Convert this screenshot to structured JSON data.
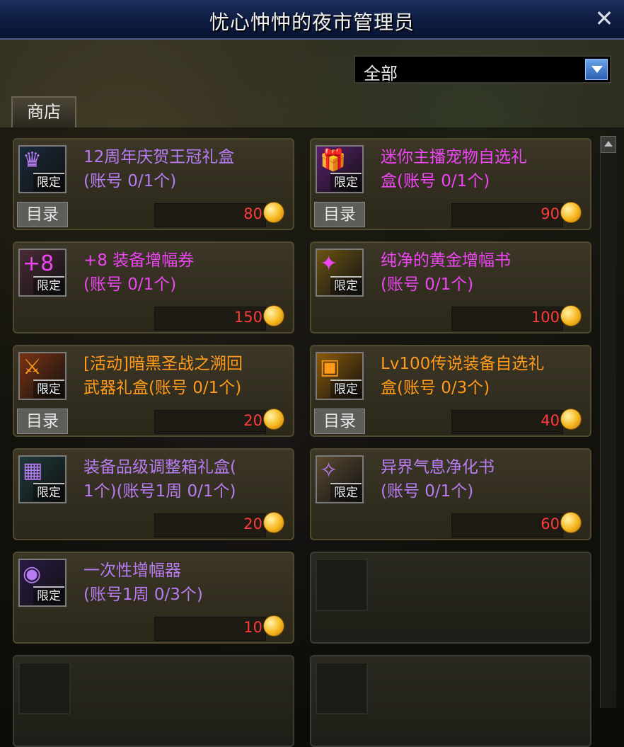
{
  "window": {
    "title": "忧心忡忡的夜市管理员",
    "close_icon": "close-icon"
  },
  "filter": {
    "selected": "全部"
  },
  "tabs": [
    {
      "label": "商店"
    }
  ],
  "colors": {
    "purple_name": "#b87cf2",
    "magenta_name": "#f045f5",
    "orange_name": "#ff9a1a",
    "price": "#ff3b3b"
  },
  "items": [
    {
      "name": "12周年庆贺王冠礼盒\n(账号 0/1个)",
      "badge": "限定",
      "catalog": "目录",
      "price": "80",
      "color": "#b87cf2",
      "icon": "crown-gift-icon",
      "icon_bg": "#1a2a3a"
    },
    {
      "name": "迷你主播宠物自选礼\n盒(账号 0/1个)",
      "badge": "限定",
      "catalog": "目录",
      "price": "90",
      "color": "#f045f5",
      "icon": "pet-gift-box-icon",
      "icon_bg": "#5a1f6e"
    },
    {
      "name": "+8 装备增幅券\n(账号 0/1个)",
      "badge": "限定",
      "catalog": "",
      "price": "150",
      "color": "#f045f5",
      "icon": "amplify-ticket-icon",
      "icon_bg": "#4a2b36"
    },
    {
      "name": "纯净的黄金增幅书\n(账号 0/1个)",
      "badge": "限定",
      "catalog": "",
      "price": "100",
      "color": "#f045f5",
      "icon": "gold-book-icon",
      "icon_bg": "#6b5412"
    },
    {
      "name": "[活动]暗黑圣战之溯回\n武器礼盒(账号 0/1个)",
      "badge": "限定",
      "catalog": "目录",
      "price": "20",
      "color": "#ff9a1a",
      "icon": "weapon-box-icon",
      "icon_bg": "#7a3214"
    },
    {
      "name": "Lv100传说装备自选礼\n盒(账号 0/3个)",
      "badge": "限定",
      "catalog": "目录",
      "price": "40",
      "color": "#ff9a1a",
      "icon": "legendary-box-icon",
      "icon_bg": "#8a5a0a"
    },
    {
      "name": "装备品级调整箱礼盒(\n1个)(账号1周 0/1个)",
      "badge": "限定",
      "catalog": "",
      "price": "20",
      "color": "#b87cf2",
      "icon": "grade-box-icon",
      "icon_bg": "#1f3a3a"
    },
    {
      "name": "异界气息净化书\n(账号 0/1个)",
      "badge": "限定",
      "catalog": "",
      "price": "60",
      "color": "#b87cf2",
      "icon": "purify-scroll-icon",
      "icon_bg": "#5a4a32"
    },
    {
      "name": "一次性增幅器\n(账号1周 0/3个)",
      "badge": "限定",
      "catalog": "",
      "price": "10",
      "color": "#b87cf2",
      "icon": "amplifier-orb-icon",
      "icon_bg": "#2a1a44"
    }
  ]
}
